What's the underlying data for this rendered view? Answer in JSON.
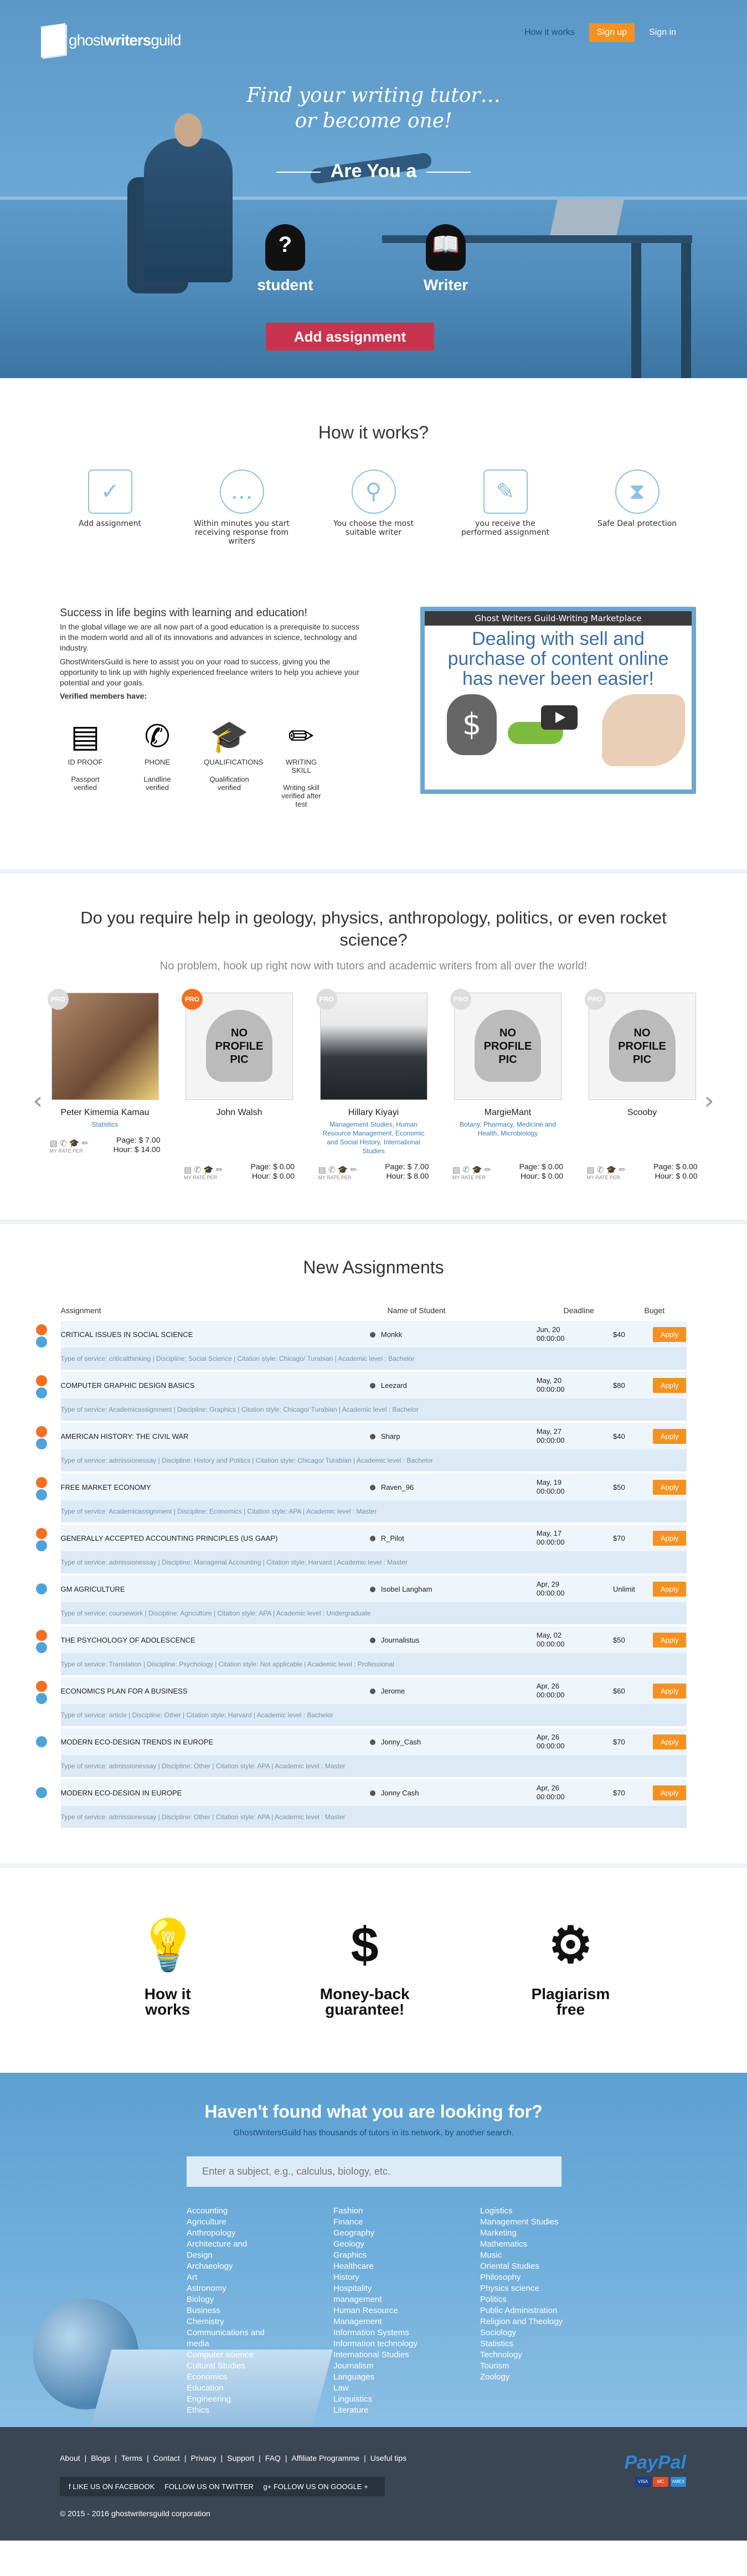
{
  "brand": {
    "logo_light": "ghost",
    "logo_bold": "writers",
    "logo_rest": "guild"
  },
  "nav": {
    "how": "How it works",
    "signup": "Sign up",
    "signin": "Sign in"
  },
  "hero": {
    "tagline1": "Find your writing tutor…",
    "tagline2": "or become one!",
    "are_you": "Are You a",
    "student": "student",
    "writer": "Writer",
    "add": "Add assignment",
    "colors": {
      "primary": "#6aa6d3",
      "accent_red": "#c9334d",
      "accent_orange": "#f39220"
    }
  },
  "how": {
    "title": "How it works?",
    "steps": [
      {
        "label": "Add assignment",
        "icon": "monitor-check-icon"
      },
      {
        "label": "Within minutes you start receiving response from writers",
        "icon": "chat-bubble-icon"
      },
      {
        "label": "You choose the most suitable writer",
        "icon": "writer-search-icon"
      },
      {
        "label": "you receive the performed assignment",
        "icon": "document-check-icon"
      },
      {
        "label": "Safe Deal protection",
        "icon": "shield-hands-icon"
      }
    ]
  },
  "success": {
    "title": "Success in life begins with learning and education!",
    "p1": "In the global village we are all now part of a good education is a prerequisite to success in the modern world and all of its innovations and advances in science, technology and industry.",
    "p2": "GhostWritersGuild is here to assist you on your road to success, giving you the opportunity to link up with highly experienced freelance writers to help you achieve your potential and your goals.",
    "verified_title": "Verified members have:",
    "badges": [
      {
        "name": "ID PROOF",
        "desc": "Passport verified",
        "icon": "passport-icon"
      },
      {
        "name": "PHONE",
        "desc": "Landline verified",
        "icon": "phone-icon"
      },
      {
        "name": "QUALIFICATIONS",
        "desc": "Qualification verified",
        "icon": "graduation-cap-icon"
      },
      {
        "name": "WRITING SKILL",
        "desc": "Writing skill verified after test",
        "icon": "pencil-icon"
      }
    ]
  },
  "video": {
    "title": "Ghost Writers Guild-Writing Marketplace",
    "headline": "Dealing with sell and purchase of content online has never been easier!"
  },
  "require": {
    "title": "Do you require help in geology, physics, anthropology, politics, or even rocket science?",
    "sub": "No problem, hook up right now with tutors and academic writers from all over the world!"
  },
  "tutors": [
    {
      "name": "Peter Kimemia Kamau",
      "subject": "Statistics",
      "pro": false,
      "photo": "photo",
      "page": "Page: $ 7.00",
      "hour": "Hour: $ 14.00"
    },
    {
      "name": "John Walsh",
      "subject": "",
      "pro": true,
      "photo": "none",
      "page": "Page: $ 0.00",
      "hour": "Hour: $ 0.00"
    },
    {
      "name": "Hillary Kiyayi",
      "subject": "Management Studies, Human Resource Management, Economic and Social History, International Studies",
      "pro": false,
      "photo": "photo",
      "page": "Page: $ 7.00",
      "hour": "Hour: $ 8.00"
    },
    {
      "name": "MargieMant",
      "subject": "Botany, Pharmacy, Medicine and Health, Microbiology",
      "pro": false,
      "photo": "none",
      "page": "Page: $ 0.00",
      "hour": "Hour: $ 0.00"
    },
    {
      "name": "Scooby",
      "subject": "",
      "pro": false,
      "photo": "none",
      "page": "Page: $ 0.00",
      "hour": "Hour: $ 0.00"
    }
  ],
  "tutor_common": {
    "pro": "PRO",
    "no_pic": "NO PROFILE PIC",
    "rate": "MY RATE PER"
  },
  "assign": {
    "title": "New Assignments",
    "headers": {
      "assignment": "Assignment",
      "student": "Name of Student",
      "deadline": "Deadline",
      "budget": "Buget"
    },
    "apply": "Apply",
    "rows": [
      {
        "title": "Critical issues in social science",
        "student": "Monkk",
        "d1": "Jun, 20",
        "d2": "00:00:00",
        "budget": "$40",
        "details": "Type of service: criticalthinking  |  Discipline: Social Science  |  Citation style: Chicago/ Turabian  |  Academic level : Bachelor"
      },
      {
        "title": "Computer graphic design basics",
        "student": "Leezard",
        "d1": "May, 20",
        "d2": "00:00:00",
        "budget": "$80",
        "details": "Type of service: Academicassignment  |  Discipline: Graphics  |  Citation style: Chicago/ Turabian  |  Academic level : Bachelor"
      },
      {
        "title": "American History: The Civil War",
        "student": "Sharp",
        "d1": "May, 27",
        "d2": "00:00:00",
        "budget": "$40",
        "details": "Type of service: admissionessay  |  Discipline: History and Politics  |  Citation style: Chicago/ Turabian  |  Academic level : Bachelor"
      },
      {
        "title": "Free market economy",
        "student": "Raven_96",
        "d1": "May, 19",
        "d2": "00:00:00",
        "budget": "$50",
        "details": "Type of service: Academicassignment  |  Discipline: Economics  |  Citation style: APA  |  Academic level : Master"
      },
      {
        "title": "Generally Accepted Accounting Principles (US GAAP)",
        "student": "R_Pilot",
        "d1": "May, 17",
        "d2": "00:00:00",
        "budget": "$70",
        "details": "Type of service: admissionessay  |  Discipline: Managerial Accounting  |  Citation style: Harvard  |  Academic level : Master"
      },
      {
        "title": "GM Agriculture",
        "student": "Isobel Langham",
        "d1": "Apr, 29",
        "d2": "00:00:00",
        "budget": "Unlimit",
        "details": "Type of service: coursework  |  Discipline: Agriculture  |  Citation style: APA  |  Academic level : Undergraduate"
      },
      {
        "title": "The Psychology of Adolescence",
        "student": "Journalistus",
        "d1": "May, 02",
        "d2": "00:00:00",
        "budget": "$50",
        "details": "Type of service: Translation  |  Discipline: Psychology  |  Citation style: Not applicable  |  Academic level : Professional"
      },
      {
        "title": "Economics Plan for a Business",
        "student": "Jerome",
        "d1": "Apr, 26",
        "d2": "00:00:00",
        "budget": "$60",
        "details": "Type of service: article  |  Discipline: Other  |  Citation style: Harvard  |  Academic level : Bachelor"
      },
      {
        "title": "Modern Eco-design trends in Europe",
        "student": "Jonny_Cash",
        "d1": "Apr, 26",
        "d2": "00:00:00",
        "budget": "$70",
        "details": "Type of service: admissionessay  |  Discipline: Other  |  Citation style: APA  |  Academic level : Master"
      },
      {
        "title": "Modern Eco-design in Europe",
        "student": "Jonny Cash",
        "d1": "Apr, 26",
        "d2": "00:00:00",
        "budget": "$70",
        "details": "Type of service: admissionessay  |  Discipline: Other  |  Citation style: APA  |  Academic level : Master"
      }
    ]
  },
  "features": [
    {
      "l1": "How it",
      "l2": "works",
      "icon": "lightbulb-head-icon"
    },
    {
      "l1": "Money-back",
      "l2": "guarantee!",
      "icon": "money-back-icon"
    },
    {
      "l1": "Plagiarism",
      "l2": "free",
      "icon": "plagiarism-check-icon"
    }
  ],
  "search": {
    "title": "Haven't found what you are looking for?",
    "sub": "GhostWritersGuild has thousands of tutors in its network, by another search.",
    "placeholder": "Enter a subject, e.g., calculus, biology, etc.",
    "col1": [
      "Accounting",
      "Agriculture",
      "Anthropology",
      "Architecture and Design",
      "Archaeology",
      "Art",
      "Astronomy",
      "Biology",
      "Business",
      "Chemistry",
      "Communications and media",
      "Computer science",
      "Cultural Studies",
      "Economics",
      "Education",
      "Engineering",
      "Ethics"
    ],
    "col2": [
      "Fashion",
      "Finance",
      "Geography",
      "Geology",
      "Graphics",
      "Healthcare",
      "History",
      "Hospitality management",
      "Human Resource Management",
      "Information Systems",
      "Information technology",
      "International Studies",
      "Journalism",
      "Languages",
      "Law",
      "Linguistics",
      "Literature"
    ],
    "col3": [
      "Logistics",
      "Management Studies",
      "Marketing",
      "Mathematics",
      "Music",
      "Oriental Studies",
      "Philosophy",
      "Physics science",
      "Politics",
      "Public Administration",
      "Religion and Theology",
      "Sociology",
      "Statistics",
      "Technology",
      "Tourism",
      "Zoology"
    ]
  },
  "footer": {
    "links": [
      "About",
      "|",
      "Blogs",
      "|",
      "Terms",
      "|",
      "Contact",
      "|",
      "Privacy",
      "|",
      "Support",
      "|",
      "FAQ",
      "|",
      "Affiliate Programme",
      "|",
      "Useful tips"
    ],
    "facebook": "f  LIKE US ON FACEBOOK",
    "twitter": "FOLLOW US ON TWITTER",
    "google": "g+  FOLLOW US ON GOOGLE +",
    "copy": "© 2015 - 2016 ghostwritersguild corporation",
    "paypal": "PayPal",
    "cards": [
      "VISA",
      "MC",
      "AMEX"
    ]
  }
}
